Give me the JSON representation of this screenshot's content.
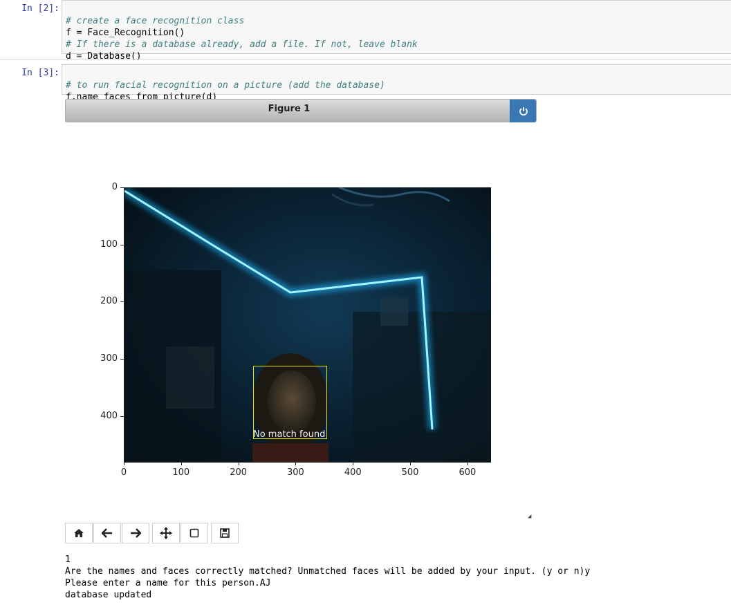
{
  "cells": [
    {
      "prompt": "In [2]:",
      "lines": [
        {
          "type": "comment",
          "text": "# create a face recognition class"
        },
        {
          "type": "code",
          "text": "f = Face_Recognition()"
        },
        {
          "type": "comment",
          "text": "# If there is a database already, add a file. If not, leave blank"
        },
        {
          "type": "code",
          "text": "d = Database()"
        }
      ]
    },
    {
      "prompt": "In [3]:",
      "lines": [
        {
          "type": "comment",
          "text": "# to run facial recognition on a picture (add the database)"
        },
        {
          "type": "code",
          "text": "f.name_faces_from_picture(d)"
        }
      ]
    }
  ],
  "figure": {
    "title": "Figure 1",
    "power_icon": "power-icon",
    "y_ticks": [
      "0",
      "100",
      "200",
      "300",
      "400"
    ],
    "x_ticks": [
      "0",
      "100",
      "200",
      "300",
      "400",
      "500",
      "600"
    ],
    "face_label": "No match found",
    "face_box_color": "#e6e600"
  },
  "toolbar": {
    "buttons": [
      {
        "name": "home-icon",
        "glyph": "⌂"
      },
      {
        "name": "back-arrow-icon",
        "glyph": "←"
      },
      {
        "name": "forward-arrow-icon",
        "glyph": "→"
      },
      {
        "name": "pan-move-icon",
        "glyph": "✥"
      },
      {
        "name": "zoom-rect-icon",
        "glyph": "☐"
      },
      {
        "name": "save-icon",
        "glyph": "💾"
      }
    ]
  },
  "output": [
    "1",
    "Are the names and faces correctly matched? Unmatched faces will be added by your input. (y or n)y",
    "Please enter a name for this person.AJ",
    "database updated"
  ]
}
